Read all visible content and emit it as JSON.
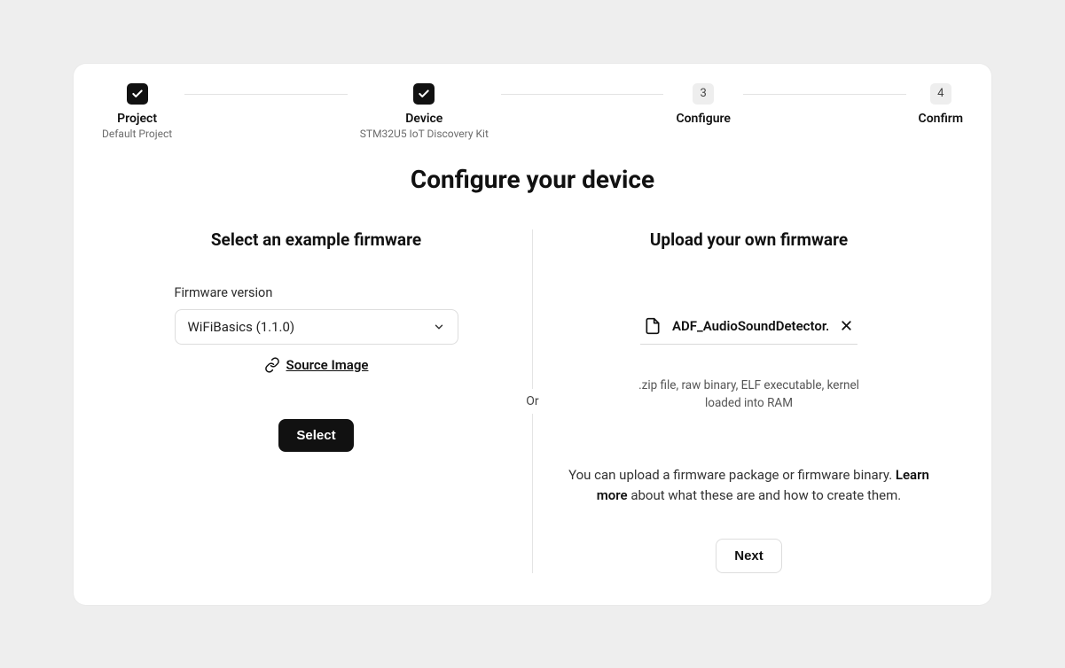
{
  "stepper": {
    "steps": [
      {
        "title": "Project",
        "subtitle": "Default Project",
        "state": "done"
      },
      {
        "title": "Device",
        "subtitle": "STM32U5 IoT Discovery Kit",
        "state": "done"
      },
      {
        "title": "Configure",
        "subtitle": "",
        "state": "pending",
        "number": "3"
      },
      {
        "title": "Confirm",
        "subtitle": "",
        "state": "pending",
        "number": "4"
      }
    ]
  },
  "page_title": "Configure your device",
  "divider_label": "Or",
  "left": {
    "title": "Select an example firmware",
    "field_label": "Firmware version",
    "select_value": "WiFiBasics (1.1.0)",
    "source_link": "Source Image",
    "button": "Select"
  },
  "right": {
    "title": "Upload your own firmware",
    "filename": "ADF_AudioSoundDetector.",
    "hint": ".zip file, raw binary, ELF executable, kernel loaded into RAM",
    "desc_prefix": "You can upload a firmware package or firmware binary. ",
    "desc_link": "Learn more",
    "desc_suffix": " about what these are and how to create them.",
    "button": "Next"
  }
}
